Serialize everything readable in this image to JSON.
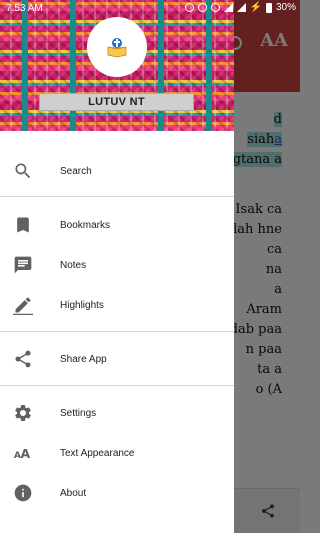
{
  "status_bar": {
    "time": "7:53 AM",
    "battery": "30%"
  },
  "drawer": {
    "title": "LUTUV NT",
    "groups": [
      [
        {
          "label": "Search",
          "icon": "search-icon"
        }
      ],
      [
        {
          "label": "Bookmarks",
          "icon": "bookmark-icon"
        },
        {
          "label": "Notes",
          "icon": "notes-icon"
        },
        {
          "label": "Highlights",
          "icon": "highlighter-icon"
        }
      ],
      [
        {
          "label": "Share App",
          "icon": "share-icon"
        }
      ],
      [
        {
          "label": "Settings",
          "icon": "gear-icon"
        },
        {
          "label": "Text Appearance",
          "icon": "text-size-icon"
        },
        {
          "label": "About",
          "icon": "info-icon"
        }
      ]
    ]
  },
  "background": {
    "toolbar_text_icon": "AA",
    "lines": [
      {
        "text": "d",
        "highlight": true
      },
      {
        "text": "siah",
        "link": "a",
        "highlight": true
      },
      {
        "text": "gtana a",
        "highlight": true
      },
      {
        "text": "Isak ca"
      },
      {
        "text": "lah hne"
      },
      {
        "text": "ca"
      },
      {
        "text": "na"
      },
      {
        "text": "a"
      },
      {
        "text": "Aram"
      },
      {
        "text": "dab paa"
      },
      {
        "text": "n paa"
      },
      {
        "text": "ta a"
      },
      {
        "text": "o (A"
      }
    ]
  },
  "colors": {
    "app_bar": "#d24440",
    "highlight": "#a9e5e5",
    "drawer_bg": "#ffffff",
    "icon": "#616161"
  }
}
